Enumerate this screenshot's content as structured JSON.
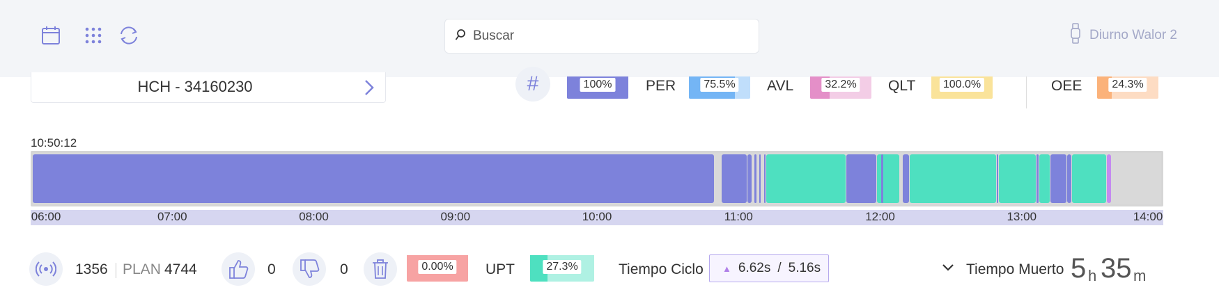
{
  "header": {
    "search_placeholder": "Buscar",
    "user_label": "Diurno Walor 2"
  },
  "machine": {
    "name": "HCH - 34160230"
  },
  "metrics": [
    {
      "label": "",
      "value": "100%",
      "fill_percent": 100,
      "color": "#7d82db"
    },
    {
      "label": "PER",
      "value": "75.5%",
      "fill_percent": 75.5,
      "color": "#74b5f5"
    },
    {
      "label": "AVL",
      "value": "32.2%",
      "fill_percent": 32.2,
      "color": "#e48fc8"
    },
    {
      "label": "QLT",
      "value": "100.0%",
      "fill_percent": 100,
      "color": "#fae39a"
    },
    {
      "label": "OEE",
      "value": "24.3%",
      "fill_percent": 24.3,
      "color": "#fbb27a"
    }
  ],
  "timeline": {
    "start_time": "10:50:12",
    "ticks": [
      "06:00",
      "07:00",
      "08:00",
      "09:00",
      "10:00",
      "11:00",
      "12:00",
      "13:00",
      "14:00"
    ],
    "segments": [
      {
        "start": "06:00",
        "end": "10:50",
        "state": "run"
      },
      {
        "start": "10:53",
        "end": "11:04",
        "state": "run"
      },
      {
        "start": "11:04",
        "end": "11:06",
        "state": "run"
      },
      {
        "start": "11:07",
        "end": "11:08",
        "state": "run"
      },
      {
        "start": "11:09",
        "end": "11:10",
        "state": "run"
      },
      {
        "start": "11:11",
        "end": "11:12",
        "state": "run"
      },
      {
        "start": "11:12",
        "end": "11:46",
        "state": "idle"
      },
      {
        "start": "11:46",
        "end": "11:59",
        "state": "run"
      },
      {
        "start": "11:59",
        "end": "12:09",
        "state": "idle"
      },
      {
        "start": "12:01",
        "end": "12:02",
        "state": "run"
      },
      {
        "start": "12:10",
        "end": "12:13",
        "state": "run"
      },
      {
        "start": "12:13",
        "end": "12:50",
        "state": "idle"
      },
      {
        "start": "12:50",
        "end": "12:51",
        "state": "run"
      },
      {
        "start": "12:51",
        "end": "13:07",
        "state": "idle"
      },
      {
        "start": "13:07",
        "end": "13:08",
        "state": "run"
      },
      {
        "start": "13:08",
        "end": "13:13",
        "state": "idle"
      },
      {
        "start": "13:13",
        "end": "13:20",
        "state": "run"
      },
      {
        "start": "13:20",
        "end": "13:22",
        "state": "run"
      },
      {
        "start": "13:22",
        "end": "13:37",
        "state": "idle"
      },
      {
        "start": "13:37",
        "end": "13:39",
        "state": "other"
      }
    ],
    "colors": {
      "run": "#7d82db",
      "idle": "#4ee0c0",
      "other": "#c48af0",
      "empty": "#d9d9d9"
    }
  },
  "counts": {
    "produced": "1356",
    "plan_label": "PLAN",
    "plan": "4744",
    "good": "0",
    "bad": "0",
    "scrap_pct": "0.00%",
    "scrap_color": "#f7a3a3"
  },
  "upt": {
    "label": "UPT",
    "value": "27.3%",
    "fill_percent": 27.3,
    "color": "#4ee0c0"
  },
  "cycle": {
    "label": "Tiempo Ciclo",
    "actual": "6.62s",
    "separator": "/",
    "target": "5.16s"
  },
  "dead_time": {
    "label": "Tiempo Muerto",
    "hours": "5",
    "hours_unit": "h",
    "minutes": "35",
    "minutes_unit": "m"
  }
}
